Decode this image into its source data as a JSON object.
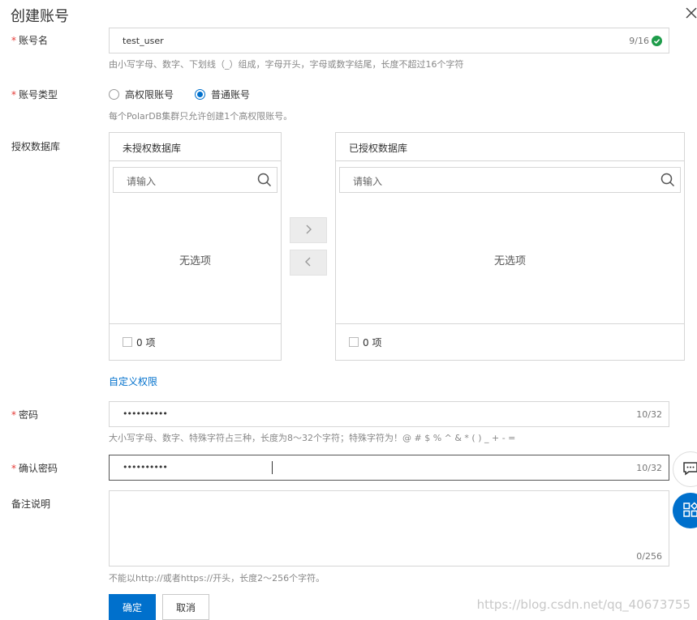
{
  "dialog": {
    "title": "创建账号",
    "close_icon": "close-icon"
  },
  "form": {
    "account_name": {
      "label": "账号名",
      "value": "test_user",
      "counter": "9/16",
      "status_icon": "check-circle-icon",
      "help": "由小写字母、数字、下划线（_）组成，字母开头，字母或数字结尾，长度不超过16个字符"
    },
    "account_type": {
      "label": "账号类型",
      "options": [
        "高权限账号",
        "普通账号"
      ],
      "selected": "普通账号",
      "help": "每个PolarDB集群只允许创建1个高权限账号。"
    },
    "databases": {
      "label": "授权数据库",
      "left": {
        "title": "未授权数据库",
        "search_placeholder": "请输入",
        "empty_text": "无选项",
        "count": "0 项"
      },
      "right": {
        "title": "已授权数据库",
        "search_placeholder": "请输入",
        "empty_text": "无选项",
        "count": "0 项"
      },
      "custom_permissions_link": "自定义权限"
    },
    "password": {
      "label": "密码",
      "value": "••••••••••",
      "counter": "10/32",
      "help": "大小写字母、数字、特殊字符占三种，长度为8～32个字符；特殊字符为！@ # $ % ^ & * ( ) _ + - ="
    },
    "confirm_password": {
      "label": "确认密码",
      "value": "••••••••••",
      "counter": "10/32"
    },
    "remark": {
      "label": "备注说明",
      "value": "",
      "counter": "0/256",
      "help": "不能以http://或者https://开头，长度2～256个字符。"
    }
  },
  "footer": {
    "confirm_label": "确定",
    "cancel_label": "取消"
  },
  "watermark": "https://blog.csdn.net/qq_40673755",
  "colors": {
    "primary": "#0070cc",
    "success": "#1e9c4a",
    "required": "#e53935",
    "border": "#d6d6d6"
  }
}
